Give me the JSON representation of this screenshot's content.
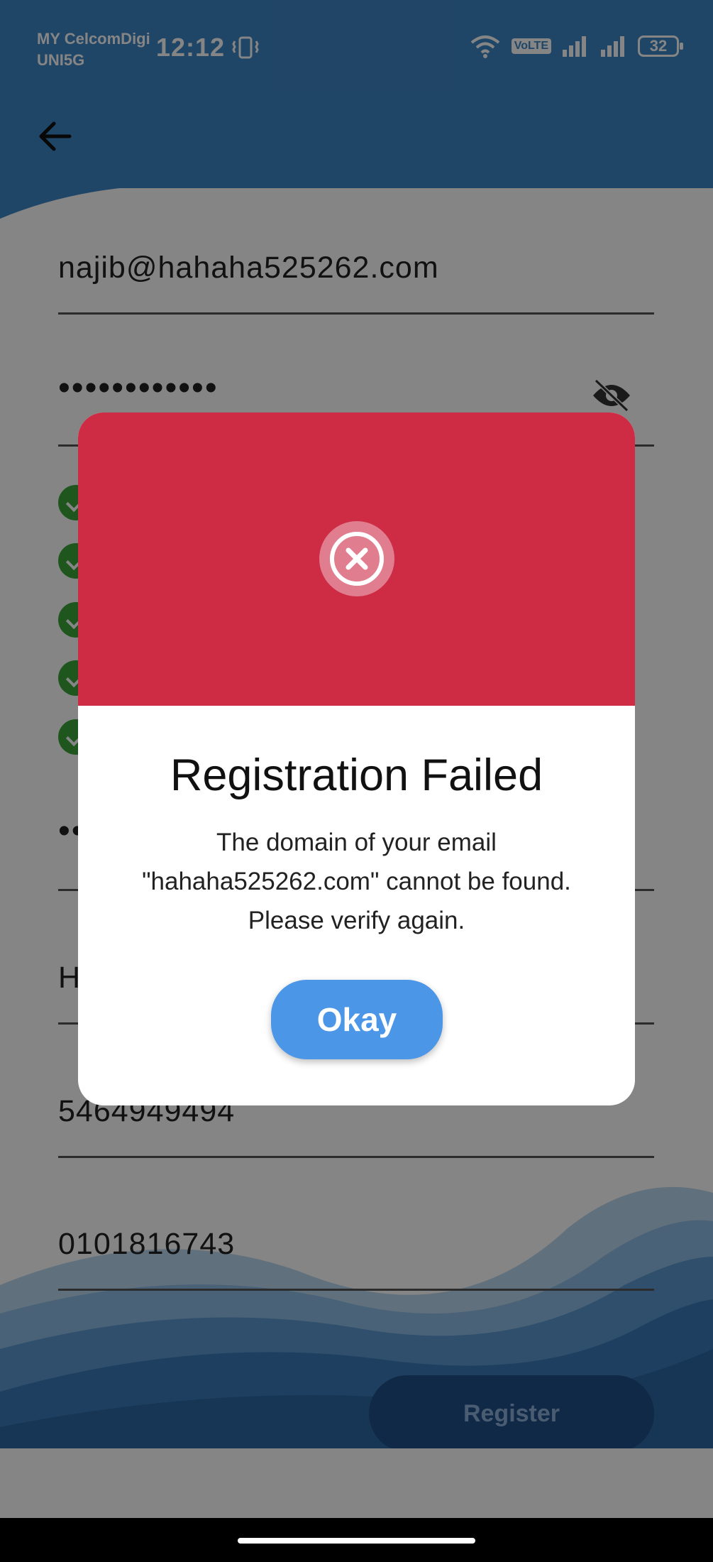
{
  "status_bar": {
    "carrier_line1": "MY CelcomDigi",
    "carrier_line2": "UNI5G",
    "time": "12:12",
    "volte_label": "VoLTE",
    "battery_level": "32"
  },
  "app_bar": {
    "back_icon": "arrow-left-icon"
  },
  "form": {
    "email_value": "najib@hahaha525262.com",
    "password_value": "••••••••••••",
    "confirm_password_value": "••",
    "name_value": "H",
    "ic_value": "5464949494",
    "phone_value": "0101816743",
    "register_label": "Register"
  },
  "dialog": {
    "title": "Registration Failed",
    "message": "The domain of your email \"hahaha525262.com\" cannot be found. Please verify again.",
    "button_label": "Okay",
    "icon": "error-circle-x-icon"
  },
  "colors": {
    "header_blue": "#3d85c6",
    "dialog_red": "#cd2c44",
    "okay_blue": "#4c96e8",
    "check_green": "#3aa63a"
  }
}
